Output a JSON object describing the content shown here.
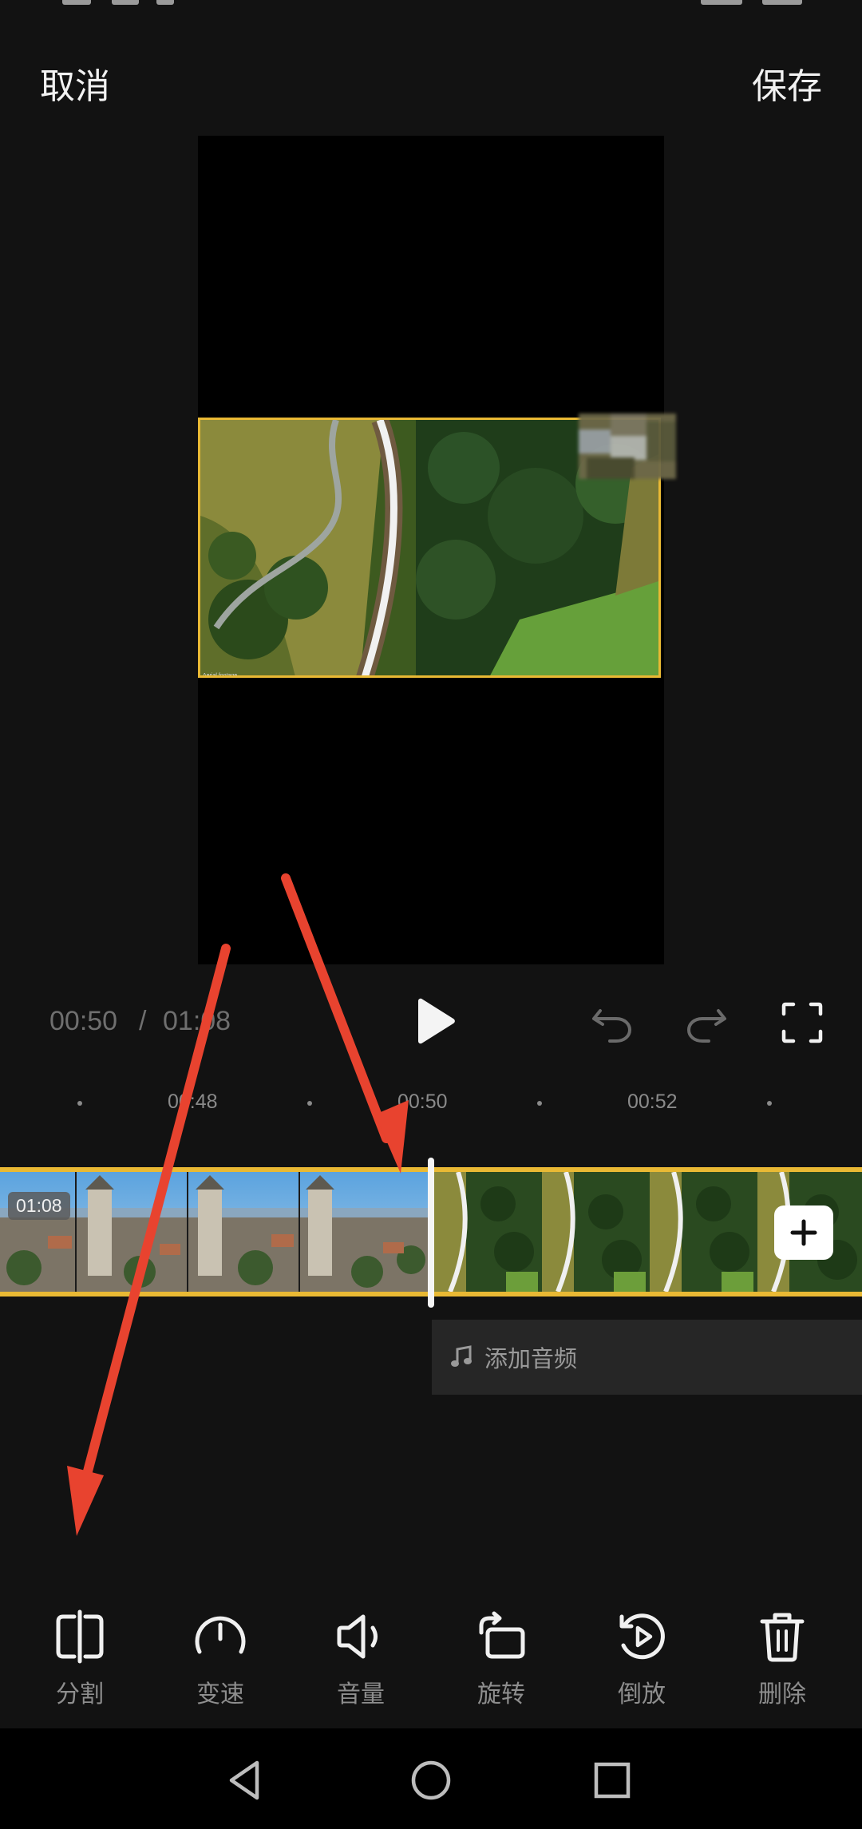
{
  "header": {
    "cancel_label": "取消",
    "save_label": "保存"
  },
  "player": {
    "current_time": "00:50",
    "separator": "/",
    "total_time": "01:08"
  },
  "ruler": {
    "ticks": [
      "00:48",
      "00:50",
      "00:52"
    ]
  },
  "timeline": {
    "clip1_duration": "01:08",
    "audio_label": "添加音频"
  },
  "tools": [
    {
      "label": "分割",
      "icon": "split-icon"
    },
    {
      "label": "变速",
      "icon": "speed-icon"
    },
    {
      "label": "音量",
      "icon": "volume-icon"
    },
    {
      "label": "旋转",
      "icon": "rotate-icon"
    },
    {
      "label": "倒放",
      "icon": "reverse-icon"
    },
    {
      "label": "删除",
      "icon": "delete-icon"
    }
  ],
  "colors": {
    "accent": "#e9b934",
    "background": "#121212",
    "annotation_arrow": "#e8432f"
  }
}
